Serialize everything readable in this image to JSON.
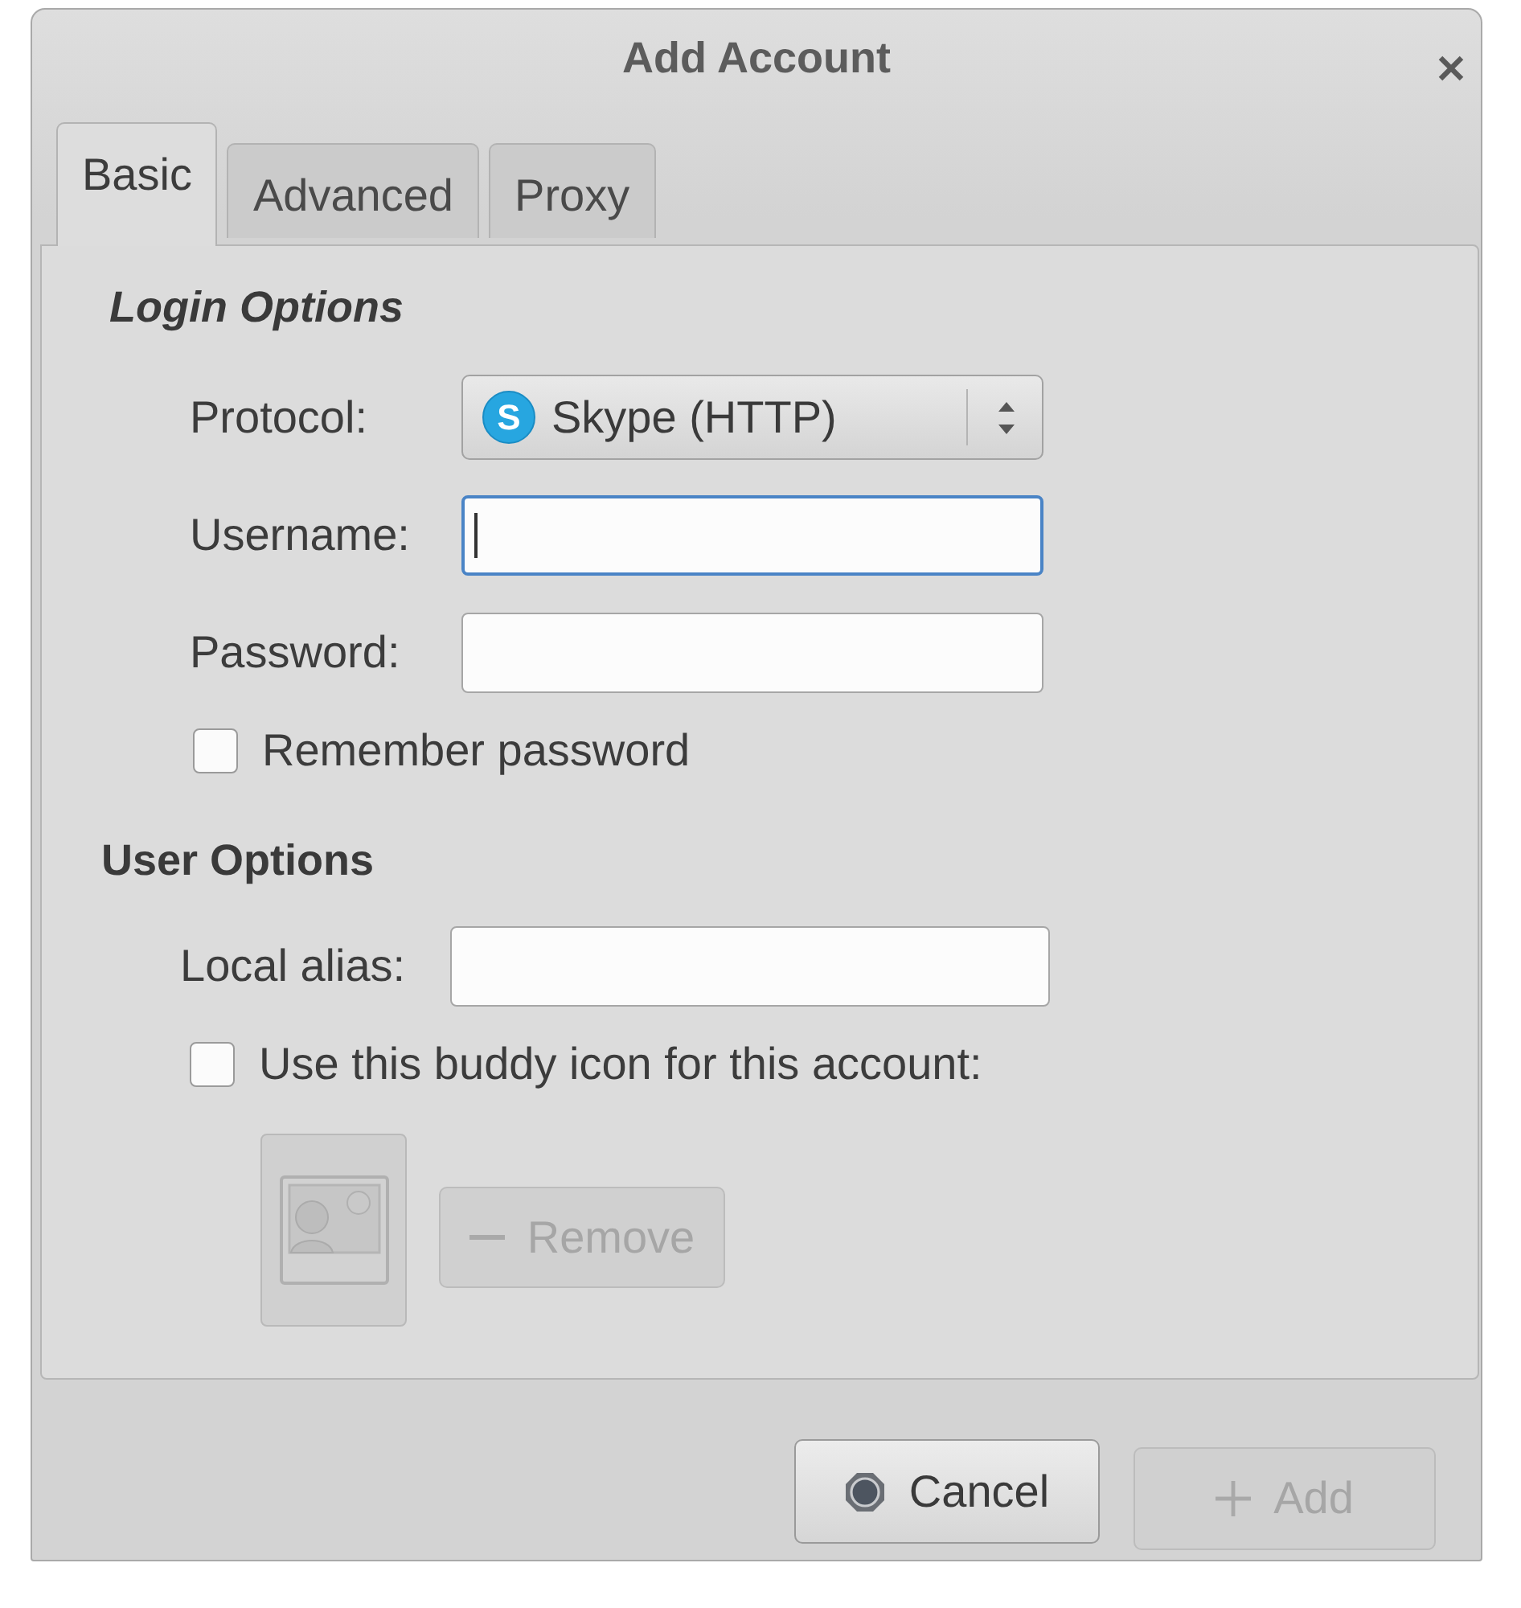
{
  "window": {
    "title": "Add Account"
  },
  "tabs": [
    {
      "label": "Basic",
      "selected": true
    },
    {
      "label": "Advanced",
      "selected": false
    },
    {
      "label": "Proxy",
      "selected": false
    }
  ],
  "login_options": {
    "heading": "Login Options",
    "fields": [
      {
        "kind": "combo",
        "label": "Protocol:",
        "value": "Skype (HTTP)",
        "icon_letter": "S"
      },
      {
        "kind": "text",
        "label": "Username:",
        "focused": true
      },
      {
        "kind": "text",
        "label": "Password:",
        "focused": false
      }
    ],
    "remember_password": {
      "label": "Remember password",
      "checked": false
    }
  },
  "user_options": {
    "heading": "User Options",
    "fields": [
      {
        "kind": "text",
        "label": "Local alias:",
        "focused": false
      }
    ],
    "buddy_icon": {
      "label": "Use this buddy icon for this account:",
      "checked": false
    },
    "icon_button": {
      "disabled": true
    },
    "remove_button": {
      "label": "Remove",
      "disabled": true
    }
  },
  "buttons": [
    {
      "kind": "cancel",
      "label": "Cancel",
      "disabled": false
    },
    {
      "kind": "add",
      "label": "Add",
      "disabled": true
    }
  ]
}
